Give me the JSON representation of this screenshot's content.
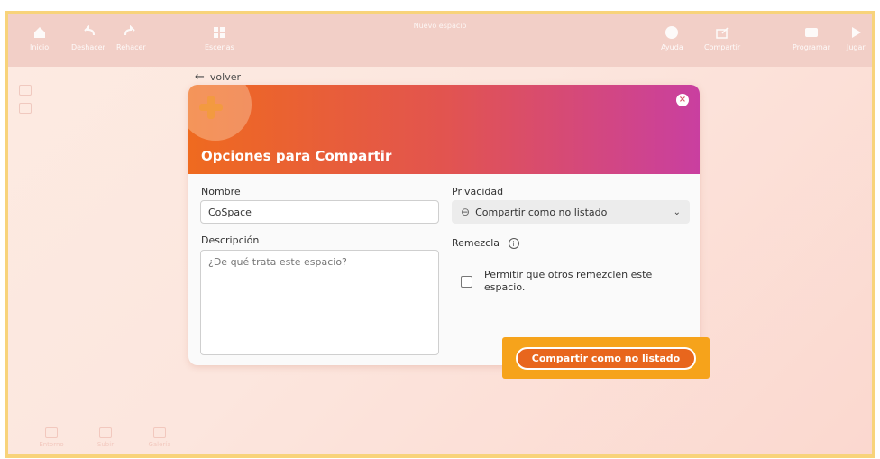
{
  "toolbar": {
    "title": "Nuevo espacio",
    "items": [
      {
        "label": "Inicio",
        "icon": "home-icon"
      },
      {
        "label": "Deshacer",
        "icon": "undo-icon"
      },
      {
        "label": "Rehacer",
        "icon": "redo-icon"
      },
      {
        "label": "Escenas",
        "icon": "grid-icon"
      },
      {
        "label": "Ayuda",
        "icon": "help-icon"
      },
      {
        "label": "Compartir",
        "icon": "share-icon"
      },
      {
        "label": "Programar",
        "icon": "code-icon"
      },
      {
        "label": "Jugar",
        "icon": "play-icon"
      }
    ]
  },
  "bottombar": {
    "items": [
      {
        "label": "Entorno",
        "icon": "environment-icon"
      },
      {
        "label": "Subir",
        "icon": "upload-icon"
      },
      {
        "label": "Galería",
        "icon": "gallery-icon"
      }
    ]
  },
  "back": {
    "arrow": "←",
    "label": "volver"
  },
  "dialog": {
    "title": "Opciones para Compartir",
    "close_symbol": "×",
    "name_label": "Nombre",
    "name_value": "CoSpace",
    "description_label": "Descripción",
    "description_placeholder": "¿De qué trata este espacio?",
    "privacy_label": "Privacidad",
    "privacy_value": "Compartir como no listado",
    "remix_label": "Remezcla",
    "info_symbol": "i",
    "remix_checkbox_label": "Permitir que otros remezclen este espacio.",
    "share_button": "Compartir como no listado"
  },
  "colors": {
    "accent": "#e8661d",
    "highlight": "#f6a31b",
    "header_start": "#ef6a1f",
    "header_end": "#c93fa0"
  }
}
